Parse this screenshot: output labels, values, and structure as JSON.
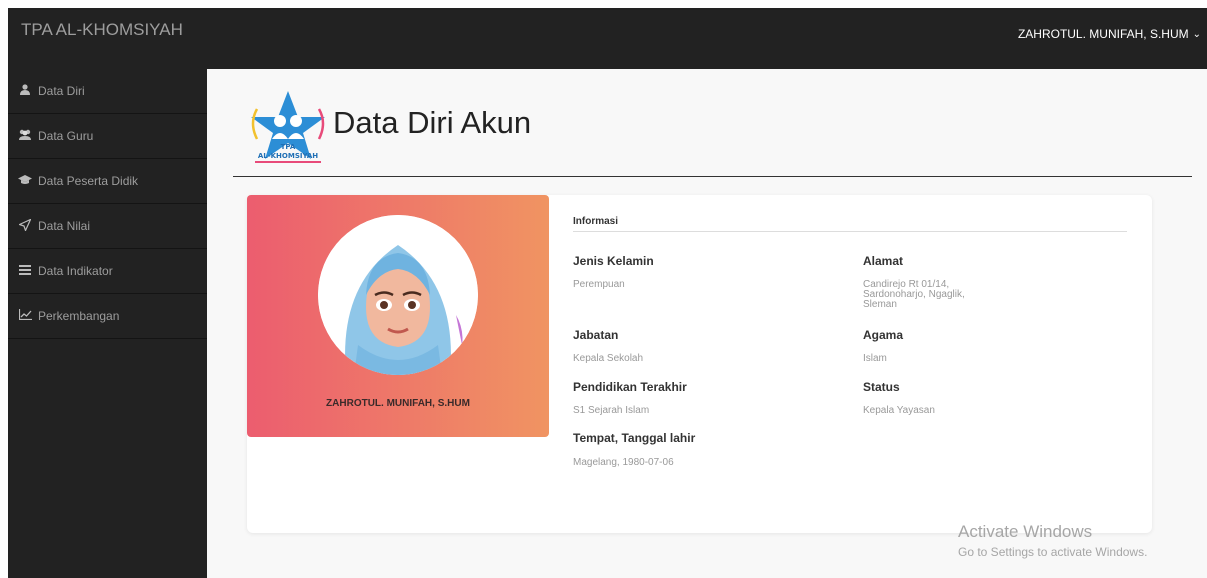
{
  "app": {
    "brand": "TPA AL-KHOMSIYAH",
    "user": "ZAHROTUL. MUNIFAH, S.HUM"
  },
  "sidebar": {
    "items": [
      {
        "label": "Data Diri",
        "icon": "user-icon"
      },
      {
        "label": "Data Guru",
        "icon": "users-icon"
      },
      {
        "label": "Data Peserta Didik",
        "icon": "graduation-cap-icon"
      },
      {
        "label": "Data Nilai",
        "icon": "paper-plane-icon"
      },
      {
        "label": "Data Indikator",
        "icon": "list-icon"
      },
      {
        "label": "Perkembangan",
        "icon": "chart-line-icon"
      }
    ]
  },
  "page": {
    "title": "Data Diri Akun",
    "logo": {
      "line1": "TPA",
      "line2": "AL-KHOMSIYAH"
    }
  },
  "profile": {
    "name": "ZAHROTUL. MUNIFAH, S.HUM"
  },
  "info": {
    "heading": "Informasi",
    "jenis_kelamin": {
      "label": "Jenis Kelamin",
      "value": "Perempuan"
    },
    "alamat": {
      "label": "Alamat",
      "value_lines": [
        "Candirejo Rt 01/14,",
        "Sardonoharjo, Ngaglik,",
        "Sleman"
      ]
    },
    "jabatan": {
      "label": "Jabatan",
      "value": "Kepala Sekolah"
    },
    "agama": {
      "label": "Agama",
      "value": "Islam"
    },
    "pendidikan": {
      "label": "Pendidikan Terakhir",
      "value": "S1 Sejarah Islam"
    },
    "status": {
      "label": "Status",
      "value": "Kepala Yayasan"
    },
    "ttl": {
      "label": "Tempat, Tanggal lahir",
      "value": "Magelang, 1980-07-06"
    }
  },
  "watermark": {
    "line1": "Activate Windows",
    "line2": "Go to Settings to activate Windows."
  },
  "colors": {
    "topbar": "#222222",
    "gradient_start": "#ec5d6f",
    "gradient_end": "#f09462"
  }
}
